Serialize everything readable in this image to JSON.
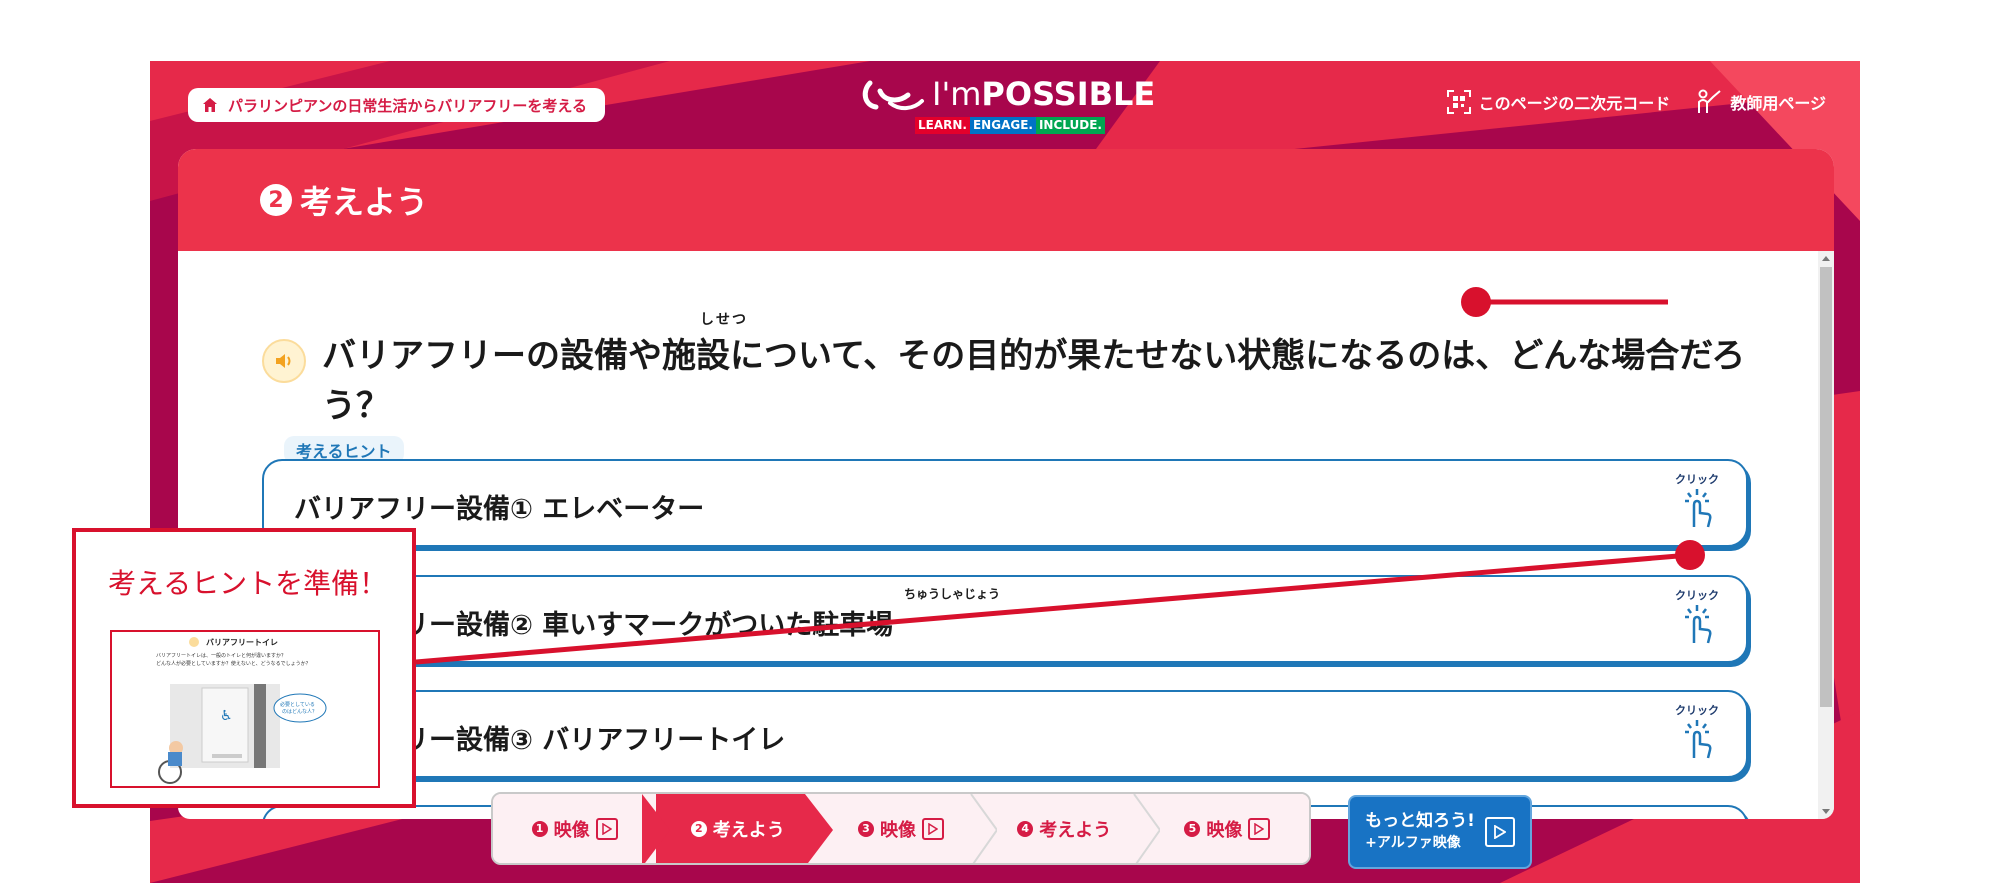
{
  "header": {
    "home_label": "パラリンピアンの日常生活からバリアフリーを考える",
    "logo_text_light": "I'm",
    "logo_text_bold": "POSSIBLE",
    "logo_tag": [
      "LEARN.",
      "ENGAGE.",
      "INCLUDE."
    ],
    "qr_label": "このページの二次元コード",
    "teacher_label": "教師用ページ"
  },
  "panel": {
    "step_num": "2",
    "title": "考えよう",
    "ruby_shisetsu": "しせつ",
    "question": "バリアフリーの設備や施設について、その目的が果たせない状態になるのは、どんな場合だろう？",
    "hint_label": "考えるヒント",
    "ruby_chushajo": "ちゅうしゃじょう",
    "cards": [
      {
        "title": "バリアフリー設備① エレベーター",
        "click": "クリック"
      },
      {
        "title": "バリアフリー設備② 車いすマークがついた駐車場",
        "click": "クリック"
      },
      {
        "title": "バリアフリー設備③ バリアフリートイレ",
        "click": "クリック"
      }
    ]
  },
  "callout": {
    "text": "考えるヒントを準備！",
    "thumb_title": "バリアフリートイレ",
    "thumb_body1": "バリアフリートイレは、一般のトイレと何が違いますか？",
    "thumb_body2": "どんな人が必要としていますか？使えないと、どうなるでしょうか？",
    "thumb_bubble": "必要としているのはどんな人？"
  },
  "stepnav": [
    {
      "num": "1",
      "label": "映像",
      "play": true,
      "active": false
    },
    {
      "num": "2",
      "label": "考えよう",
      "play": false,
      "active": true
    },
    {
      "num": "3",
      "label": "映像",
      "play": true,
      "active": false
    },
    {
      "num": "4",
      "label": "考えよう",
      "play": false,
      "active": false
    },
    {
      "num": "5",
      "label": "映像",
      "play": true,
      "active": false
    }
  ],
  "more": {
    "line1": "もっと知ろう!",
    "line2": "+アルファ映像"
  },
  "colors": {
    "brand_red": "#ec334b",
    "brand_dark": "#a8064c",
    "accent_blue": "#1f77b7",
    "annotation_red": "#d8112d"
  }
}
